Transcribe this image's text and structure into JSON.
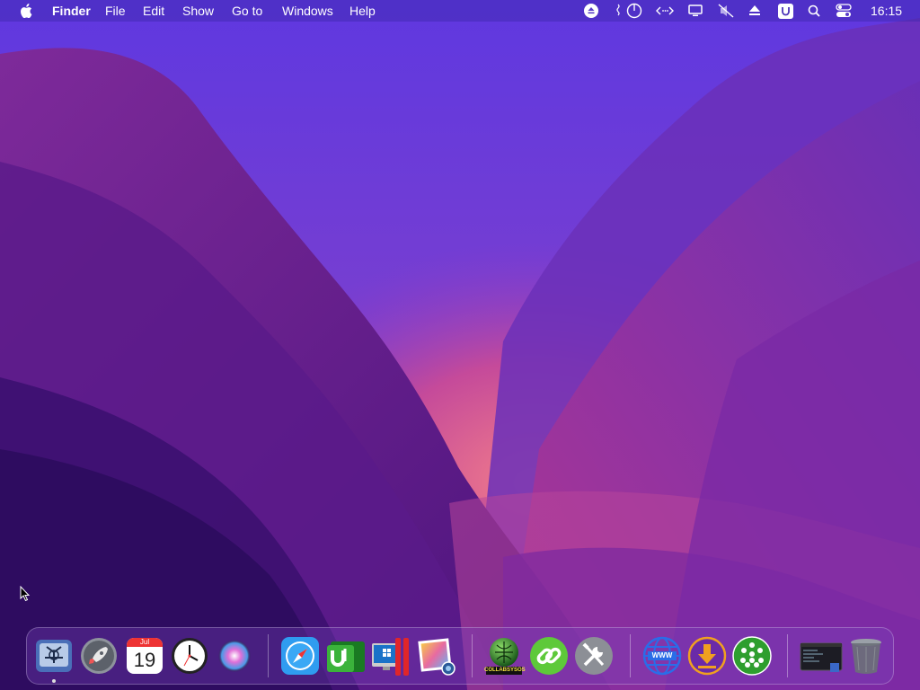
{
  "menubar": {
    "app_name": "Finder",
    "menus": [
      "File",
      "Edit",
      "Show",
      "Go to",
      "Windows",
      "Help"
    ],
    "status_icons": [
      "eject-circle-icon",
      "power-icon",
      "network-arrows-icon",
      "display-icon",
      "mute-icon",
      "eject-icon",
      "u-icon",
      "search-icon",
      "control-center-icon"
    ],
    "clock": "16:15"
  },
  "dock": {
    "apps": [
      {
        "name": "finder-like-app",
        "running": true
      },
      {
        "name": "launchpad"
      },
      {
        "name": "calendar",
        "month": "Jul",
        "day": "19"
      },
      {
        "name": "clock"
      },
      {
        "name": "siri"
      },
      {
        "name": "safari"
      },
      {
        "name": "utorrent"
      },
      {
        "name": "parallels-desktop"
      },
      {
        "name": "preview"
      },
      {
        "name": "collabsysos",
        "label": "COLLABSYSOS"
      },
      {
        "name": "link-app"
      },
      {
        "name": "system-tools"
      },
      {
        "name": "www-app",
        "label": "WWW"
      },
      {
        "name": "downloader"
      },
      {
        "name": "people-network-app"
      },
      {
        "name": "terminal-window"
      },
      {
        "name": "trash"
      }
    ]
  },
  "colors": {
    "sky_top": "#6a3fe0",
    "valley_glow": "#e86a8c",
    "mountain_dark": "#3b0f6e"
  }
}
